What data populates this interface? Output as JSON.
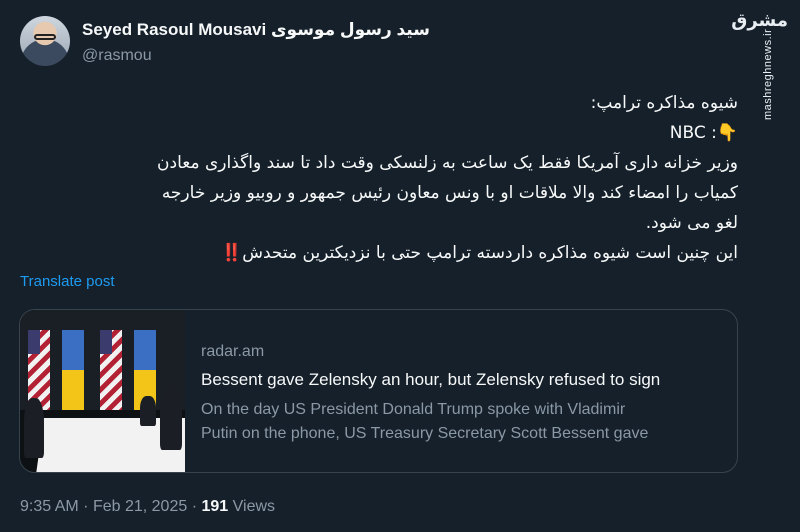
{
  "author": {
    "name": "Seyed Rasoul Mousavi سید رسول موسوی",
    "handle": "@rasmou"
  },
  "watermark": {
    "logo": "مشرق",
    "url": "mashreghnews.ir"
  },
  "tweet": {
    "lines": [
      "شیوه مذاکره ترامپ:",
      "👇: NBC",
      "وزیر خزانه داری آمریکا فقط یک ساعت به زلنسکی وقت داد تا سند واگذاری معادن",
      "کمیاب را امضاء کند والا ملاقات او  با ونس معاون رئیس جمهور و روبیو وزیر خارجه",
      "لغو می شود.",
      "این چنین است شیوه مذاکره داردسته ترامپ حتی با نزدیکترین متحدش‼️"
    ],
    "translate_label": "Translate post"
  },
  "card": {
    "domain": "radar.am",
    "title": "Bessent gave Zelensky an hour, but Zelensky refused to sign",
    "description_line1": "On the day US President Donald Trump spoke with Vladimir",
    "description_line2": "Putin on the phone, US Treasury Secretary Scott Bessent gave"
  },
  "meta": {
    "time": "9:35 AM",
    "separator": "·",
    "date": "Feb 21, 2025",
    "views_count": "191",
    "views_label": "Views"
  }
}
